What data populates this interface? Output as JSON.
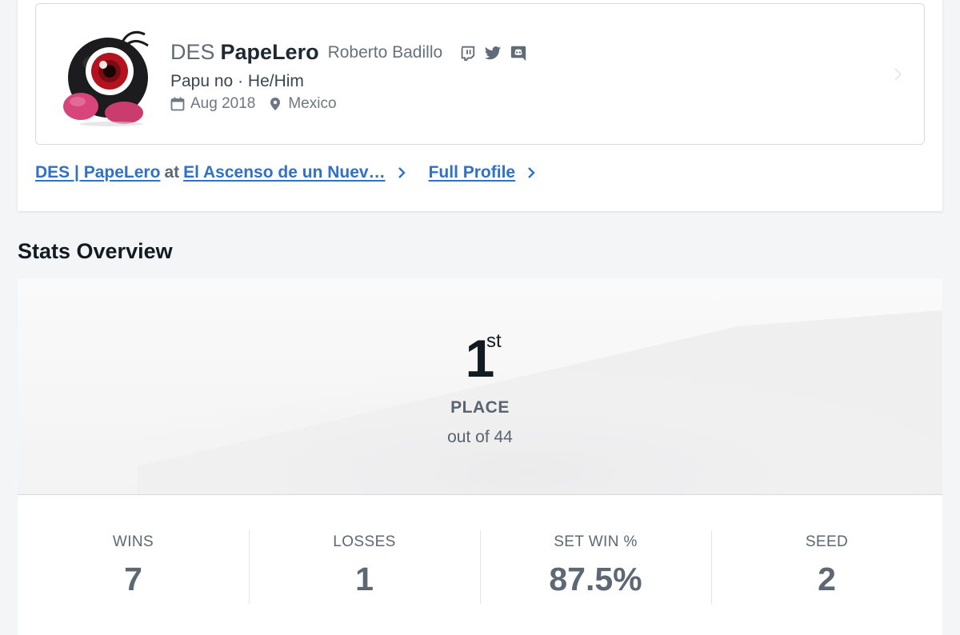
{
  "profile": {
    "prefix": "DES",
    "gamertag": "PapeLero",
    "real_name": "Roberto Badillo",
    "social_icons": [
      "twitch-icon",
      "twitter-icon",
      "discord-icon"
    ],
    "bio": "Papu no · He/Him",
    "joined": "Aug 2018",
    "location": "Mexico"
  },
  "links": {
    "entrant_name": "DES | PapeLero",
    "at_word": "at",
    "event_name": "El Ascenso de un Nuev…",
    "full_profile": "Full Profile"
  },
  "stats_overview": {
    "title": "Stats Overview",
    "place": "1",
    "place_suffix": "st",
    "place_label": "PLACE",
    "out_of": "out of 44"
  },
  "stats": [
    {
      "label": "WINS",
      "value": "7"
    },
    {
      "label": "LOSSES",
      "value": "1"
    },
    {
      "label": "SET WIN %",
      "value": "87.5%"
    },
    {
      "label": "SEED",
      "value": "2"
    }
  ],
  "colors": {
    "link": "#3171c3",
    "text_dark": "#121a22",
    "text_muted": "#5d6873"
  }
}
